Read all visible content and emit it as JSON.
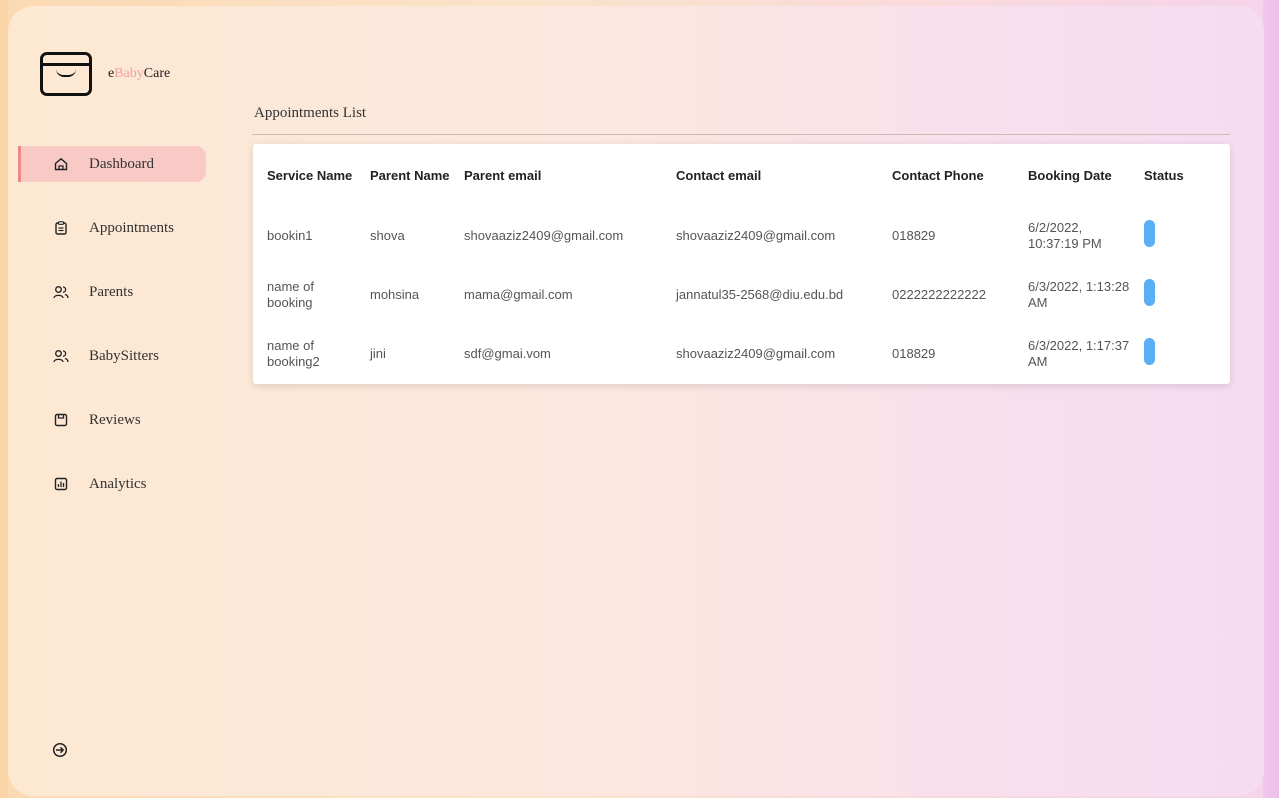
{
  "brand": {
    "prefix": "e",
    "highlight": "Baby",
    "suffix": "Care"
  },
  "sidebar": {
    "items": [
      {
        "label": "Dashboard",
        "icon": "home-icon",
        "active": true
      },
      {
        "label": "Appointments",
        "icon": "clipboard-icon",
        "active": false
      },
      {
        "label": "Parents",
        "icon": "users-icon",
        "active": false
      },
      {
        "label": "BabySitters",
        "icon": "users-icon",
        "active": false
      },
      {
        "label": "Reviews",
        "icon": "comment-box-icon",
        "active": false
      },
      {
        "label": "Analytics",
        "icon": "bar-chart-icon",
        "active": false
      }
    ],
    "logout_icon": "logout-icon"
  },
  "main": {
    "title": "Appointments List",
    "table": {
      "headers": [
        "Service Name",
        "Parent Name",
        "Parent email",
        "Contact email",
        "Contact Phone",
        "Booking Date",
        "Status"
      ],
      "rows": [
        [
          "bookin1",
          "shova",
          "shovaaziz2409@gmail.com",
          "shovaaziz2409@gmail.com",
          "018829",
          "6/2/2022, 10:37:19 PM"
        ],
        [
          "name of booking",
          "mohsina",
          "mama@gmail.com",
          "jannatul35-2568@diu.edu.bd",
          "0222222222222",
          "6/3/2022, 1:13:28 AM"
        ],
        [
          "name of booking2",
          "jini",
          "sdf@gmai.vom",
          "shovaaziz2409@gmail.com",
          "018829",
          "6/3/2022, 1:17:37 AM"
        ]
      ]
    }
  },
  "colors": {
    "active_nav": "#f9c9c6",
    "status_pill": "#5aaef6",
    "brand_highlight": "#f0a1a8"
  }
}
